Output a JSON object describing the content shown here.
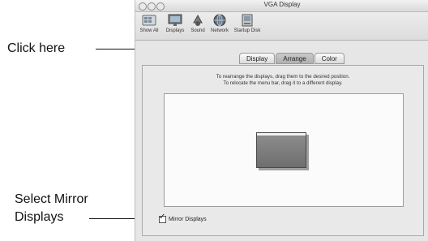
{
  "callouts": {
    "click_here": "Click here",
    "select_mirror_line1": "Select Mirror",
    "select_mirror_line2": "Displays"
  },
  "window": {
    "title": "VGA Display"
  },
  "toolbar": {
    "items": [
      {
        "label": "Show All",
        "icon": "show-all-icon"
      },
      {
        "label": "Displays",
        "icon": "displays-icon"
      },
      {
        "label": "Sound",
        "icon": "sound-icon"
      },
      {
        "label": "Network",
        "icon": "network-icon"
      },
      {
        "label": "Startup Disk",
        "icon": "startup-disk-icon"
      }
    ]
  },
  "tabs": {
    "display": "Display",
    "arrange": "Arrange",
    "color": "Color",
    "selected": "Arrange"
  },
  "arrange": {
    "line1": "To rearrange the displays, drag them to the desired position.",
    "line2": "To relocate the menu bar, drag it to a different display."
  },
  "mirror": {
    "label": "Mirror Displays",
    "checked": true
  }
}
